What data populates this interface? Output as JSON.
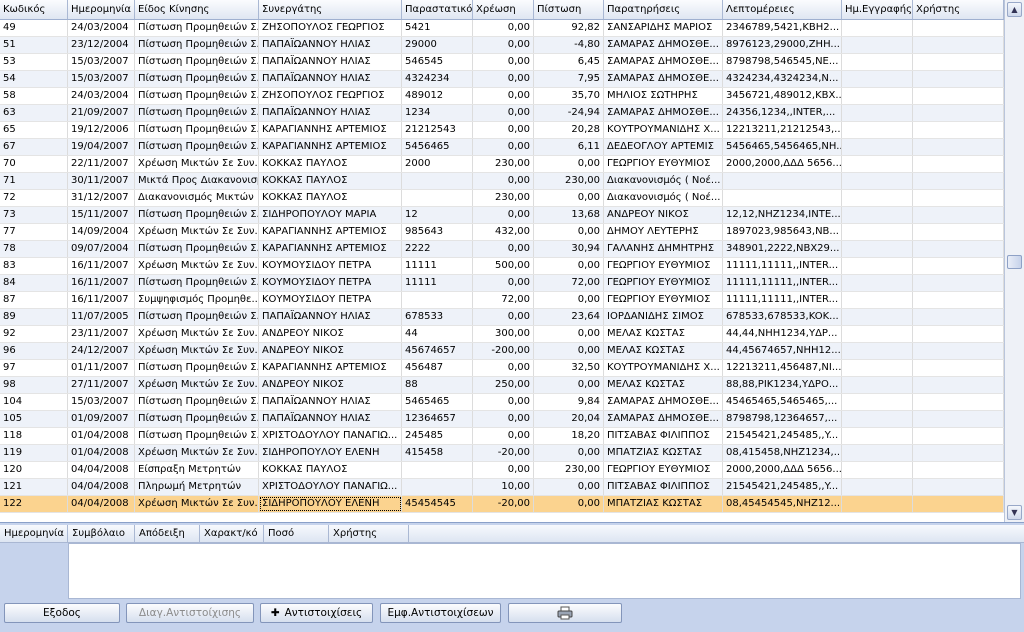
{
  "grid": {
    "columns": [
      "Κωδικός",
      "Ημερομηνία",
      "Είδος Κίνησης",
      "Συνεργάτης",
      "Παραστατικό",
      "Χρέωση",
      "Πίστωση",
      "Παρατηρήσεις",
      "Λεπτομέρειες",
      "Ημ.Εγγραφής",
      "Χρήστης"
    ],
    "rows": [
      [
        "49",
        "24/03/2004",
        "Πίστωση Προμηθειών Σ...",
        "ΖΗΣΟΠΟΥΛΟΣ ΓΕΩΡΓΙΟΣ",
        "5421",
        "0,00",
        "92,82",
        "ΣΑΝΣΑΡΙΔΗΣ ΜΑΡΙΟΣ",
        "2346789,5421,KBH2...",
        "",
        ""
      ],
      [
        "51",
        "23/12/2004",
        "Πίστωση Προμηθειών Σ...",
        "ΠΑΠΑΪΩΑΝΝΟΥ ΗΛΙΑΣ",
        "29000",
        "0,00",
        "-4,80",
        "ΣΑΜΑΡΑΣ ΔΗΜΟΣΘΕ...",
        "8976123,29000,ZHH...",
        "",
        ""
      ],
      [
        "53",
        "15/03/2007",
        "Πίστωση Προμηθειών Σ...",
        "ΠΑΠΑΪΩΑΝΝΟΥ ΗΛΙΑΣ",
        "546545",
        "0,00",
        "6,45",
        "ΣΑΜΑΡΑΣ ΔΗΜΟΣΘΕ...",
        "8798798,546545,NE...",
        "",
        ""
      ],
      [
        "54",
        "15/03/2007",
        "Πίστωση Προμηθειών Σ...",
        "ΠΑΠΑΪΩΑΝΝΟΥ ΗΛΙΑΣ",
        "4324234",
        "0,00",
        "7,95",
        "ΣΑΜΑΡΑΣ ΔΗΜΟΣΘΕ...",
        "4324234,4324234,N...",
        "",
        ""
      ],
      [
        "58",
        "24/03/2004",
        "Πίστωση Προμηθειών Σ...",
        "ΖΗΣΟΠΟΥΛΟΣ ΓΕΩΡΓΙΟΣ",
        "489012",
        "0,00",
        "35,70",
        "ΜΗΛΙΟΣ ΣΩΤΗΡΗΣ",
        "3456721,489012,KBX...",
        "",
        ""
      ],
      [
        "63",
        "21/09/2007",
        "Πίστωση Προμηθειών Σ...",
        "ΠΑΠΑΪΩΑΝΝΟΥ ΗΛΙΑΣ",
        "1234",
        "0,00",
        "-24,94",
        "ΣΑΜΑΡΑΣ ΔΗΜΟΣΘΕ...",
        "24356,1234,,INTER,...",
        "",
        ""
      ],
      [
        "65",
        "19/12/2006",
        "Πίστωση Προμηθειών Σ...",
        "ΚΑΡΑΓΙΑΝΝΗΣ ΑΡΤΕΜΙΟΣ",
        "21212543",
        "0,00",
        "20,28",
        "ΚΟΥΤΡΟΥΜΑΝΙΔΗΣ Χ...",
        "12213211,21212543,...",
        "",
        ""
      ],
      [
        "67",
        "19/04/2007",
        "Πίστωση Προμηθειών Σ...",
        "ΚΑΡΑΓΙΑΝΝΗΣ ΑΡΤΕΜΙΟΣ",
        "5456465",
        "0,00",
        "6,11",
        "ΔΕΔΕΟΓΛΟΥ ΑΡΤΕΜΙΣ",
        "5456465,5456465,NH...",
        "",
        ""
      ],
      [
        "70",
        "22/11/2007",
        "Χρέωση Μικτών Σε Συν...",
        "ΚΟΚΚΑΣ ΠΑΥΛΟΣ",
        "2000",
        "230,00",
        "0,00",
        "ΓΕΩΡΓΙΟΥ ΕΥΘΥΜΙΟΣ",
        "2000,2000,ΔΔΔ 5656...",
        "",
        ""
      ],
      [
        "71",
        "30/11/2007",
        "Μικτά Προς Διακανονισμό",
        "ΚΟΚΚΑΣ ΠΑΥΛΟΣ",
        "",
        "0,00",
        "230,00",
        "Διακανονισμός ( Νοέ...",
        "",
        "",
        ""
      ],
      [
        "72",
        "31/12/2007",
        "Διακανονισμός Μικτών",
        "ΚΟΚΚΑΣ ΠΑΥΛΟΣ",
        "",
        "230,00",
        "0,00",
        "Διακανονισμός ( Νοέ...",
        "",
        "",
        ""
      ],
      [
        "73",
        "15/11/2007",
        "Πίστωση Προμηθειών Σ...",
        "ΣΙΔΗΡΟΠΟΥΛΟΥ ΜΑΡΙΑ",
        "12",
        "0,00",
        "13,68",
        "ΑΝΔΡΕΟΥ ΝΙΚΟΣ",
        "12,12,NHZ1234,INTE...",
        "",
        ""
      ],
      [
        "77",
        "14/09/2004",
        "Χρέωση Μικτών Σε Συν...",
        "ΚΑΡΑΓΙΑΝΝΗΣ ΑΡΤΕΜΙΟΣ",
        "985643",
        "432,00",
        "0,00",
        "ΔΗΜΟΥ ΛΕΥΤΕΡΗΣ",
        "1897023,985643,NB...",
        "",
        ""
      ],
      [
        "78",
        "09/07/2004",
        "Πίστωση Προμηθειών Σ...",
        "ΚΑΡΑΓΙΑΝΝΗΣ ΑΡΤΕΜΙΟΣ",
        "2222",
        "0,00",
        "30,94",
        "ΓΑΛΑΝΗΣ ΔΗΜΗΤΡΗΣ",
        "348901,2222,NBX29...",
        "",
        ""
      ],
      [
        "83",
        "16/11/2007",
        "Χρέωση Μικτών Σε Συν...",
        "ΚΟΥΜΟΥΣΙΔΟΥ ΠΕΤΡΑ",
        "11111",
        "500,00",
        "0,00",
        "ΓΕΩΡΓΙΟΥ ΕΥΘΥΜΙΟΣ",
        "11111,11111,,INTER...",
        "",
        ""
      ],
      [
        "84",
        "16/11/2007",
        "Πίστωση Προμηθειών Σ...",
        "ΚΟΥΜΟΥΣΙΔΟΥ ΠΕΤΡΑ",
        "11111",
        "0,00",
        "72,00",
        "ΓΕΩΡΓΙΟΥ ΕΥΘΥΜΙΟΣ",
        "11111,11111,,INTER...",
        "",
        ""
      ],
      [
        "87",
        "16/11/2007",
        "Συμψηφισμός Προμηθε...",
        "ΚΟΥΜΟΥΣΙΔΟΥ ΠΕΤΡΑ",
        "",
        "72,00",
        "0,00",
        "ΓΕΩΡΓΙΟΥ ΕΥΘΥΜΙΟΣ",
        "11111,11111,,INTER...",
        "",
        ""
      ],
      [
        "89",
        "11/07/2005",
        "Πίστωση Προμηθειών Σ...",
        "ΠΑΠΑΪΩΑΝΝΟΥ ΗΛΙΑΣ",
        "678533",
        "0,00",
        "23,64",
        "ΙΟΡΔΑΝΙΔΗΣ ΣΙΜΟΣ",
        "678533,678533,KOK...",
        "",
        ""
      ],
      [
        "92",
        "23/11/2007",
        "Χρέωση Μικτών Σε Συν...",
        "ΑΝΔΡΕΟΥ ΝΙΚΟΣ",
        "44",
        "300,00",
        "0,00",
        "ΜΕΛΑΣ ΚΩΣΤΑΣ",
        "44,44,NHH1234,ΥΔΡ...",
        "",
        ""
      ],
      [
        "96",
        "24/12/2007",
        "Χρέωση Μικτών Σε Συν...",
        "ΑΝΔΡΕΟΥ ΝΙΚΟΣ",
        "45674657",
        "-200,00",
        "0,00",
        "ΜΕΛΑΣ ΚΩΣΤΑΣ",
        "44,45674657,NHH12...",
        "",
        ""
      ],
      [
        "97",
        "01/11/2007",
        "Πίστωση Προμηθειών Σ...",
        "ΚΑΡΑΓΙΑΝΝΗΣ ΑΡΤΕΜΙΟΣ",
        "456487",
        "0,00",
        "32,50",
        "ΚΟΥΤΡΟΥΜΑΝΙΔΗΣ Χ...",
        "12213211,456487,NI...",
        "",
        ""
      ],
      [
        "98",
        "27/11/2007",
        "Χρέωση Μικτών Σε Συν...",
        "ΑΝΔΡΕΟΥ ΝΙΚΟΣ",
        "88",
        "250,00",
        "0,00",
        "ΜΕΛΑΣ ΚΩΣΤΑΣ",
        "88,88,PIK1234,ΥΔΡΟ...",
        "",
        ""
      ],
      [
        "104",
        "15/03/2007",
        "Πίστωση Προμηθειών Σ...",
        "ΠΑΠΑΪΩΑΝΝΟΥ ΗΛΙΑΣ",
        "5465465",
        "0,00",
        "9,84",
        "ΣΑΜΑΡΑΣ ΔΗΜΟΣΘΕ...",
        "45465465,5465465,...",
        "",
        ""
      ],
      [
        "105",
        "01/09/2007",
        "Πίστωση Προμηθειών Σ...",
        "ΠΑΠΑΪΩΑΝΝΟΥ ΗΛΙΑΣ",
        "12364657",
        "0,00",
        "20,04",
        "ΣΑΜΑΡΑΣ ΔΗΜΟΣΘΕ...",
        "8798798,12364657,...",
        "",
        ""
      ],
      [
        "118",
        "01/04/2008",
        "Πίστωση Προμηθειών Σ...",
        "ΧΡΙΣΤΟΔΟΥΛΟΥ ΠΑΝΑΓΙΩ...",
        "245485",
        "0,00",
        "18,20",
        "ΠΙΤΣΑΒΑΣ ΦΙΛΙΠΠΟΣ",
        "21545421,245485,,Y...",
        "",
        ""
      ],
      [
        "119",
        "01/04/2008",
        "Χρέωση Μικτών Σε Συν...",
        "ΣΙΔΗΡΟΠΟΥΛΟΥ ΕΛΕΝΗ",
        "415458",
        "-20,00",
        "0,00",
        "ΜΠΑΤΖΙΑΣ ΚΩΣΤΑΣ",
        "08,415458,NHZ1234,...",
        "",
        ""
      ],
      [
        "120",
        "04/04/2008",
        "Είσπραξη Μετρητών",
        "ΚΟΚΚΑΣ ΠΑΥΛΟΣ",
        "",
        "0,00",
        "230,00",
        "ΓΕΩΡΓΙΟΥ ΕΥΘΥΜΙΟΣ",
        "2000,2000,ΔΔΔ 5656...",
        "",
        ""
      ],
      [
        "121",
        "04/04/2008",
        "Πληρωμή Μετρητών",
        "ΧΡΙΣΤΟΔΟΥΛΟΥ ΠΑΝΑΓΙΩ...",
        "",
        "10,00",
        "0,00",
        "ΠΙΤΣΑΒΑΣ ΦΙΛΙΠΠΟΣ",
        "21545421,245485,,Y...",
        "",
        ""
      ],
      [
        "122",
        "04/04/2008",
        "Χρέωση Μικτών Σε Συν...",
        "ΣΙΔΗΡΟΠΟΥΛΟΥ ΕΛΕΝΗ",
        "45454545",
        "-20,00",
        "0,00",
        "ΜΠΑΤΖΙΑΣ ΚΩΣΤΑΣ",
        "08,45454545,NHZ12...",
        "",
        ""
      ]
    ],
    "selected_row": 28
  },
  "detail": {
    "columns": [
      "Ημερομηνία",
      "Συμβόλαιο",
      "Απόδειξη",
      "Χαρακτ/κό",
      "Ποσό",
      "Χρήστης"
    ]
  },
  "buttons": {
    "exit": "Εξοδος",
    "delete_matching": "Διαγ.Αντιστοίχισης",
    "matchings": "Αντιστοιχίσεις",
    "show_matchings": "Εμφ.Αντιστοιχίσεων"
  },
  "icons": {
    "plus": "plus-icon",
    "printer": "printer-icon"
  }
}
